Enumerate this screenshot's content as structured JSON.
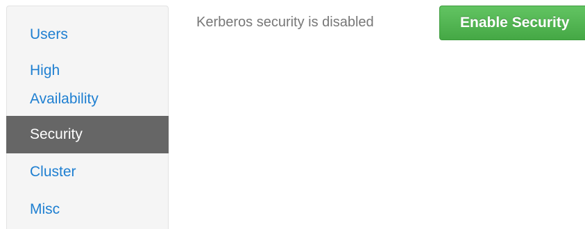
{
  "sidebar": {
    "items": [
      {
        "label": "Users"
      },
      {
        "label_line1": "High",
        "label_line2": "Availability"
      },
      {
        "label": "Security"
      },
      {
        "label": "Cluster"
      },
      {
        "label": "Misc"
      }
    ],
    "active_item": "Security"
  },
  "main": {
    "status_text": "Kerberos security is disabled",
    "enable_button_label": "Enable Security"
  },
  "colors": {
    "link": "#1e7fd1",
    "active_bg": "#666666",
    "button_green": "#51b351",
    "status_text": "#777777"
  }
}
